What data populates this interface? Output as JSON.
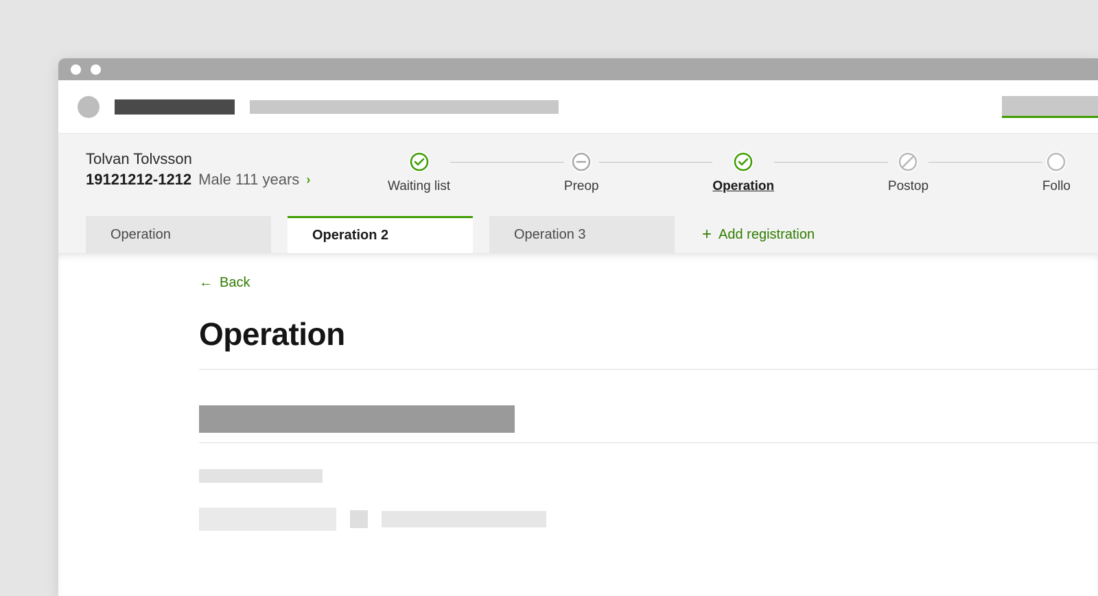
{
  "patient": {
    "name": "Tolvan Tolvsson",
    "id": "19121212-1212",
    "demographics": "Male 111 years"
  },
  "stepper": {
    "steps": [
      {
        "label": "Waiting list",
        "status": "done"
      },
      {
        "label": "Preop",
        "status": "skipped"
      },
      {
        "label": "Operation",
        "status": "done",
        "active": true
      },
      {
        "label": "Postop",
        "status": "disabled"
      },
      {
        "label": "Follo",
        "status": "future"
      }
    ]
  },
  "tabs": {
    "items": [
      {
        "label": "Operation"
      },
      {
        "label": "Operation 2",
        "active": true
      },
      {
        "label": "Operation 3"
      }
    ],
    "add_label": "Add registration"
  },
  "content": {
    "back_label": "Back",
    "title": "Operation"
  }
}
